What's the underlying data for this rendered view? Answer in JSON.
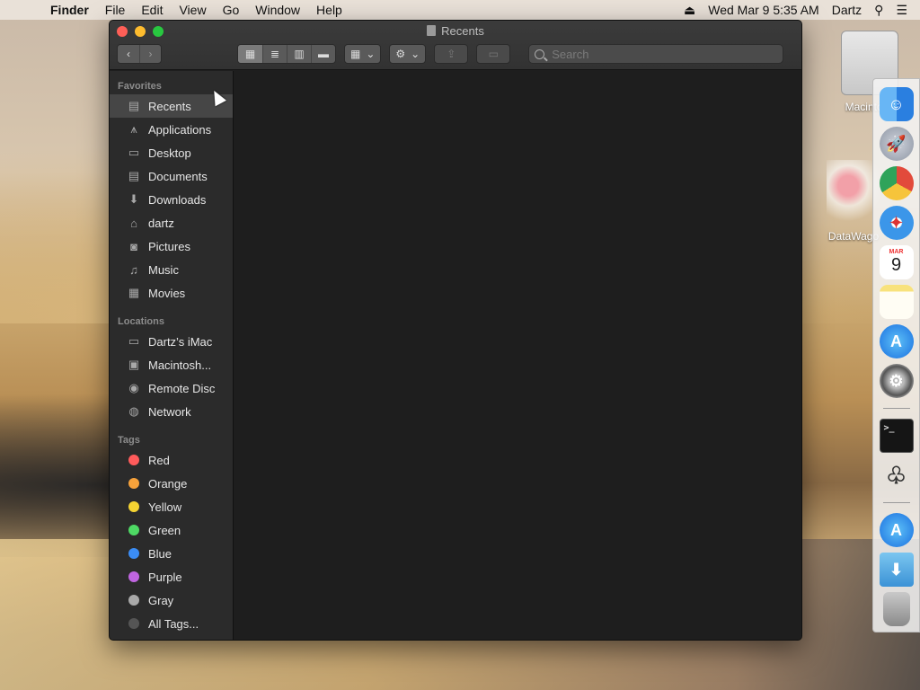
{
  "menubar": {
    "app_name": "Finder",
    "items": [
      "File",
      "Edit",
      "View",
      "Go",
      "Window",
      "Help"
    ],
    "datetime": "Wed Mar 9  5:35 AM",
    "user": "Dartz"
  },
  "window": {
    "title": "Recents",
    "search_placeholder": "Search"
  },
  "sidebar": {
    "favorites_title": "Favorites",
    "favorites": [
      {
        "label": "Recents",
        "icon": "recents-icon"
      },
      {
        "label": "Applications",
        "icon": "applications-icon"
      },
      {
        "label": "Desktop",
        "icon": "desktop-icon"
      },
      {
        "label": "Documents",
        "icon": "documents-icon"
      },
      {
        "label": "Downloads",
        "icon": "downloads-icon"
      },
      {
        "label": "dartz",
        "icon": "home-icon"
      },
      {
        "label": "Pictures",
        "icon": "camera-icon"
      },
      {
        "label": "Music",
        "icon": "music-icon"
      },
      {
        "label": "Movies",
        "icon": "film-icon"
      }
    ],
    "locations_title": "Locations",
    "locations": [
      {
        "label": "Dartz’s iMac",
        "icon": "imac-icon"
      },
      {
        "label": "Macintosh...",
        "icon": "hard-drive-icon"
      },
      {
        "label": "Remote Disc",
        "icon": "disc-icon"
      },
      {
        "label": "Network",
        "icon": "globe-icon"
      }
    ],
    "tags_title": "Tags",
    "tags": [
      {
        "label": "Red",
        "color": "#ff5b5b"
      },
      {
        "label": "Orange",
        "color": "#f7a23b"
      },
      {
        "label": "Yellow",
        "color": "#f4d332"
      },
      {
        "label": "Green",
        "color": "#4ed964"
      },
      {
        "label": "Blue",
        "color": "#3b8df5"
      },
      {
        "label": "Purple",
        "color": "#c065e0"
      },
      {
        "label": "Gray",
        "color": "#a9a9a9"
      }
    ],
    "all_tags": "All Tags..."
  },
  "desktop": {
    "hd_label": "Macintosh",
    "dw_label": "DataWago"
  },
  "dock": {
    "calendar_month": "MAR",
    "calendar_day": "9"
  }
}
